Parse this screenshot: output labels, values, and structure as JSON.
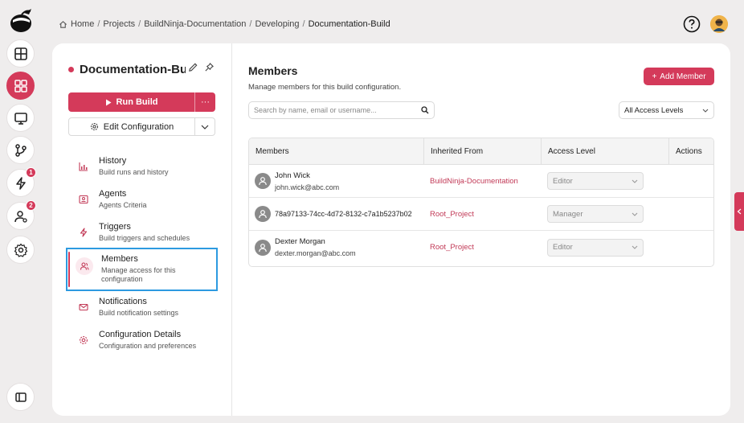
{
  "breadcrumb": [
    {
      "label": "Home"
    },
    {
      "label": "Projects"
    },
    {
      "label": "BuildNinja-Documentation"
    },
    {
      "label": "Developing"
    },
    {
      "label": "Documentation-Build"
    }
  ],
  "rail": {
    "badges": {
      "builds": "1",
      "users": "2"
    }
  },
  "config": {
    "name": "Documentation-Bu...",
    "run_label": "Run Build",
    "more_label": "···",
    "edit_label": "Edit Configuration"
  },
  "nav": [
    {
      "label": "History",
      "sub": "Build runs and history"
    },
    {
      "label": "Agents",
      "sub": "Agents Criteria"
    },
    {
      "label": "Triggers",
      "sub": "Build triggers and schedules"
    },
    {
      "label": "Members",
      "sub": "Manage access for this configuration"
    },
    {
      "label": "Notifications",
      "sub": "Build notification settings"
    },
    {
      "label": "Configuration Details",
      "sub": "Configuration and preferences"
    }
  ],
  "members": {
    "title": "Members",
    "subtitle": "Manage members for this build configuration.",
    "add_label": "Add Member",
    "search_placeholder": "Search by name, email or username...",
    "filter_value": "All Access Levels",
    "columns": [
      "Members",
      "Inherited From",
      "Access Level",
      "Actions"
    ],
    "rows": [
      {
        "name": "John Wick",
        "email": "john.wick@abc.com",
        "inherited": "BuildNinja-Documentation",
        "level": "Editor"
      },
      {
        "name": "78a97133-74cc-4d72-8132-c7a1b5237b02",
        "email": "",
        "inherited": "Root_Project",
        "level": "Manager"
      },
      {
        "name": "Dexter Morgan",
        "email": "dexter.morgan@abc.com",
        "inherited": "Root_Project",
        "level": "Editor"
      }
    ]
  },
  "colors": {
    "accent": "#d43a5a",
    "focus": "#2d9ae0"
  }
}
